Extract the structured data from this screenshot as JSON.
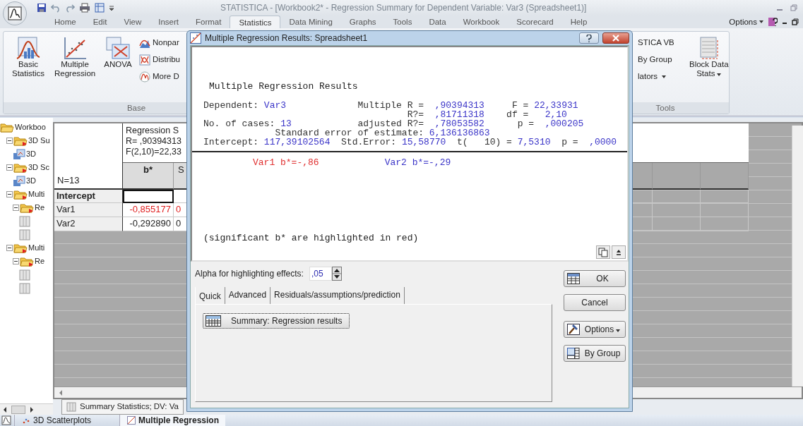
{
  "window": {
    "title": "STATISTICA - [Workbook2* - Regression Summary for Dependent Variable: Var3 (Spreadsheet1)]"
  },
  "ribbon_tabs": [
    {
      "label": "Home",
      "selected": false
    },
    {
      "label": "Edit",
      "selected": false
    },
    {
      "label": "View",
      "selected": false
    },
    {
      "label": "Insert",
      "selected": false
    },
    {
      "label": "Format",
      "selected": false
    },
    {
      "label": "Statistics",
      "selected": true
    },
    {
      "label": "Data Mining",
      "selected": false
    },
    {
      "label": "Graphs",
      "selected": false
    },
    {
      "label": "Tools",
      "selected": false
    },
    {
      "label": "Data",
      "selected": false
    },
    {
      "label": "Workbook",
      "selected": false
    },
    {
      "label": "Scorecard",
      "selected": false
    },
    {
      "label": "Help",
      "selected": false
    }
  ],
  "options_menu": {
    "label": "Options"
  },
  "ribbon_groups": [
    {
      "label": "Base",
      "items": [
        {
          "kind": "large",
          "label": "Basic Statistics"
        },
        {
          "kind": "large",
          "label": "Multiple Regression"
        },
        {
          "kind": "large",
          "label": "ANOVA"
        },
        {
          "kind": "small",
          "label": "Nonpar"
        },
        {
          "kind": "small",
          "label": "Distribu"
        },
        {
          "kind": "small",
          "label": "More D"
        }
      ]
    },
    {
      "label": "Tools",
      "items": [
        {
          "kind": "small",
          "label": "STICA VB"
        },
        {
          "kind": "small",
          "label": "By Group"
        },
        {
          "kind": "small",
          "label": "lators",
          "dropdown": true
        },
        {
          "kind": "large",
          "label": "Block Data Stats",
          "dropdown": true
        }
      ]
    }
  ],
  "tree": [
    {
      "label": "Workboo",
      "kind": "workbook",
      "children": [
        {
          "label": "3D Su",
          "kind": "folder",
          "expanded": true,
          "children": [
            {
              "label": "3D",
              "kind": "graph"
            }
          ]
        },
        {
          "label": "3D Sc",
          "kind": "folder",
          "expanded": true,
          "children": [
            {
              "label": "3D",
              "kind": "graph"
            }
          ]
        },
        {
          "label": "Multi",
          "kind": "folder",
          "expanded": true,
          "children": [
            {
              "label": "Re",
              "kind": "folder",
              "expanded": true,
              "children": [
                {
                  "kind": "sheet"
                },
                {
                  "kind": "sheet"
                }
              ]
            }
          ]
        },
        {
          "label": "Multi",
          "kind": "folder",
          "expanded": true,
          "children": [
            {
              "label": "Re",
              "kind": "folder",
              "expanded": true,
              "children": [
                {
                  "kind": "sheet"
                },
                {
                  "kind": "sheet"
                }
              ]
            }
          ]
        }
      ]
    }
  ],
  "sheet": {
    "title_lines": [
      "Regression S",
      "R= ,90394313",
      "F(2,10)=22,33"
    ],
    "corner_label": "N=13",
    "columns": [
      {
        "label": "b*"
      },
      {
        "label": "S"
      }
    ],
    "rows": [
      {
        "label": "Intercept",
        "selected": true
      },
      {
        "label": "Var1",
        "selected": false,
        "cells": [
          {
            "text": "-0,855177",
            "highlighted": true
          },
          {
            "text": "0",
            "highlighted": true
          }
        ]
      },
      {
        "label": "Var2",
        "selected": false,
        "cells": [
          {
            "text": "-0,292890",
            "highlighted": false
          },
          {
            "text": "0",
            "highlighted": false
          }
        ]
      }
    ],
    "tab": {
      "label": "Summary Statistics; DV: Va"
    }
  },
  "dialog": {
    "title": "Multiple Regression Results: Spreadsheet1",
    "output": {
      "heading": "Multiple Regression Results",
      "lines": [
        [
          {
            "text": "Dependent: ",
            "kind": "label"
          },
          {
            "text": "Var3",
            "kind": "value"
          },
          {
            "text": "             Multiple R =  ",
            "kind": "label"
          },
          {
            "text": ",90394313",
            "kind": "value"
          },
          {
            "text": "     F = ",
            "kind": "label"
          },
          {
            "text": "22,33931",
            "kind": "value"
          }
        ],
        [
          {
            "text": "                                     R?=  ",
            "kind": "label"
          },
          {
            "text": ",81711318",
            "kind": "value"
          },
          {
            "text": "    df =   ",
            "kind": "label"
          },
          {
            "text": "2,10",
            "kind": "value"
          }
        ],
        [
          {
            "text": "No. of cases: ",
            "kind": "label"
          },
          {
            "text": "13",
            "kind": "value"
          },
          {
            "text": "            adjusted R?=  ",
            "kind": "label"
          },
          {
            "text": ",78053582",
            "kind": "value"
          },
          {
            "text": "      p =  ",
            "kind": "label"
          },
          {
            "text": ",000205",
            "kind": "value"
          }
        ],
        [
          {
            "text": "             Standard error of estimate: ",
            "kind": "label"
          },
          {
            "text": "6,136136863",
            "kind": "value"
          }
        ],
        [
          {
            "text": "Intercept: ",
            "kind": "label"
          },
          {
            "text": "117,39102564",
            "kind": "value"
          },
          {
            "text": "  Std.Error: ",
            "kind": "label"
          },
          {
            "text": "15,58770",
            "kind": "value"
          },
          {
            "text": "  t(   10) = ",
            "kind": "label"
          },
          {
            "text": "7,5310",
            "kind": "value"
          },
          {
            "text": "  p =  ",
            "kind": "label"
          },
          {
            "text": ",0000",
            "kind": "value"
          }
        ]
      ],
      "effects": [
        {
          "text": "Var1 b*=-,86",
          "significant": true
        },
        {
          "text": "Var2 b*=-,29",
          "significant": false
        }
      ],
      "footnote": "(significant b* are highlighted in red)"
    },
    "alpha": {
      "label": "Alpha for highlighting effects:",
      "value": ",05"
    },
    "tabs": [
      {
        "label": "Quick",
        "selected": true
      },
      {
        "label": "Advanced",
        "selected": false
      },
      {
        "label": "Residuals/assumptions/prediction",
        "selected": false
      }
    ],
    "tab_buttons": [
      {
        "label": "Summary:  Regression results"
      }
    ],
    "side_buttons": [
      {
        "label": "OK",
        "kind": "ok"
      },
      {
        "label": "Cancel",
        "kind": "plain"
      },
      {
        "label": "Options",
        "kind": "menu"
      },
      {
        "label": "By Group",
        "kind": "group"
      }
    ]
  },
  "taskbar": [
    {
      "label": "3D Scatterplots",
      "selected": false
    },
    {
      "label": "Multiple Regression",
      "selected": true
    }
  ]
}
